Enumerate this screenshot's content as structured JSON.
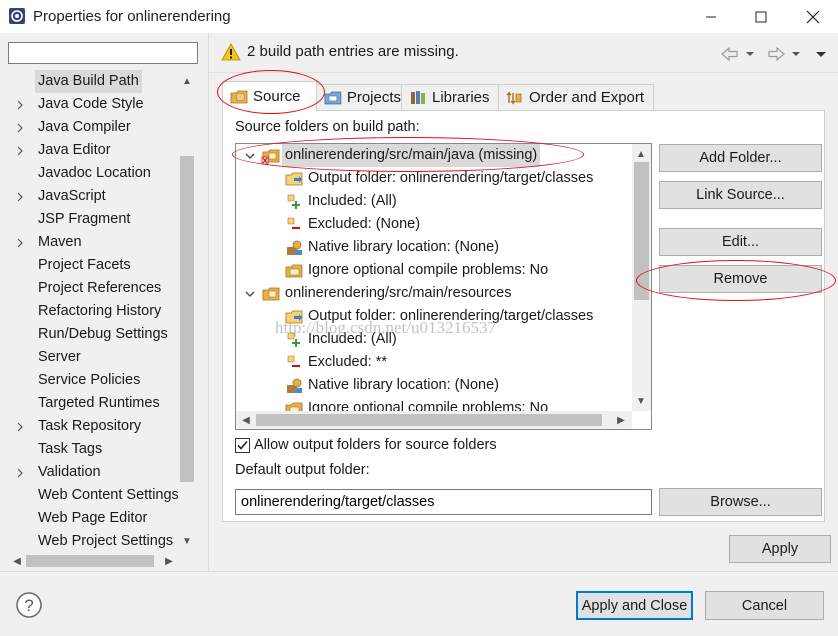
{
  "window": {
    "title": "Properties for onlinerendering",
    "minimize_icon": "minimize-icon",
    "maximize_icon": "maximize-icon",
    "close_icon": "close-icon"
  },
  "filter": {
    "value": "",
    "placeholder": ""
  },
  "nav_items": [
    {
      "label": "Java Build Path",
      "expandable": false,
      "selected": true
    },
    {
      "label": "Java Code Style",
      "expandable": true
    },
    {
      "label": "Java Compiler",
      "expandable": true
    },
    {
      "label": "Java Editor",
      "expandable": true
    },
    {
      "label": "Javadoc Location",
      "expandable": false
    },
    {
      "label": "JavaScript",
      "expandable": true
    },
    {
      "label": "JSP Fragment",
      "expandable": false
    },
    {
      "label": "Maven",
      "expandable": true
    },
    {
      "label": "Project Facets",
      "expandable": false
    },
    {
      "label": "Project References",
      "expandable": false
    },
    {
      "label": "Refactoring History",
      "expandable": false
    },
    {
      "label": "Run/Debug Settings",
      "expandable": false
    },
    {
      "label": "Server",
      "expandable": false
    },
    {
      "label": "Service Policies",
      "expandable": false
    },
    {
      "label": "Targeted Runtimes",
      "expandable": false
    },
    {
      "label": "Task Repository",
      "expandable": true
    },
    {
      "label": "Task Tags",
      "expandable": false
    },
    {
      "label": "Validation",
      "expandable": true
    },
    {
      "label": "Web Content Settings",
      "expandable": false
    },
    {
      "label": "Web Page Editor",
      "expandable": false
    },
    {
      "label": "Web Project Settings",
      "expandable": false
    }
  ],
  "header": {
    "message": "2 build path entries are missing.",
    "warning_icon": "warning-icon"
  },
  "tabs": [
    {
      "label": "Source",
      "active": true
    },
    {
      "label": "Projects"
    },
    {
      "label": "Libraries"
    },
    {
      "label": "Order and Export"
    }
  ],
  "source_panel": {
    "label": "Source folders on build path:",
    "tree": [
      {
        "level": 0,
        "text": "onlinerendering/src/main/java (missing)",
        "icon": "source-folder-missing-icon",
        "selected": true
      },
      {
        "level": 1,
        "text": "Output folder: onlinerendering/target/classes",
        "icon": "output-folder-icon"
      },
      {
        "level": 1,
        "text": "Included: (All)",
        "icon": "included-icon"
      },
      {
        "level": 1,
        "text": "Excluded: (None)",
        "icon": "excluded-icon"
      },
      {
        "level": 1,
        "text": "Native library location: (None)",
        "icon": "native-library-icon"
      },
      {
        "level": 1,
        "text": "Ignore optional compile problems: No",
        "icon": "ignore-problems-icon"
      },
      {
        "level": 0,
        "text": "onlinerendering/src/main/resources",
        "icon": "source-folder-icon"
      },
      {
        "level": 1,
        "text": "Output folder: onlinerendering/target/classes",
        "icon": "output-folder-icon"
      },
      {
        "level": 1,
        "text": "Included: (All)",
        "icon": "included-icon"
      },
      {
        "level": 1,
        "text": "Excluded: **",
        "icon": "excluded-icon"
      },
      {
        "level": 1,
        "text": "Native library location: (None)",
        "icon": "native-library-icon"
      },
      {
        "level": 1,
        "text": "Ignore optional compile problems: No",
        "icon": "ignore-problems-icon"
      }
    ],
    "buttons": {
      "add_folder": "Add Folder...",
      "link_source": "Link Source...",
      "edit": "Edit...",
      "remove": "Remove"
    },
    "allow_output_label": "Allow output folders for source folders",
    "allow_output_checked": true,
    "default_output_label": "Default output folder:",
    "default_output_value": "onlinerendering/target/classes",
    "browse": "Browse..."
  },
  "apply": "Apply",
  "footer": {
    "apply_and_close": "Apply and Close",
    "cancel": "Cancel",
    "help_icon": "help-icon"
  },
  "watermark": "http://blog.csdn.net/u013216537",
  "colors": {
    "accent": "#0078d7",
    "annotation": "#e01010",
    "warning": "#f2c811"
  }
}
